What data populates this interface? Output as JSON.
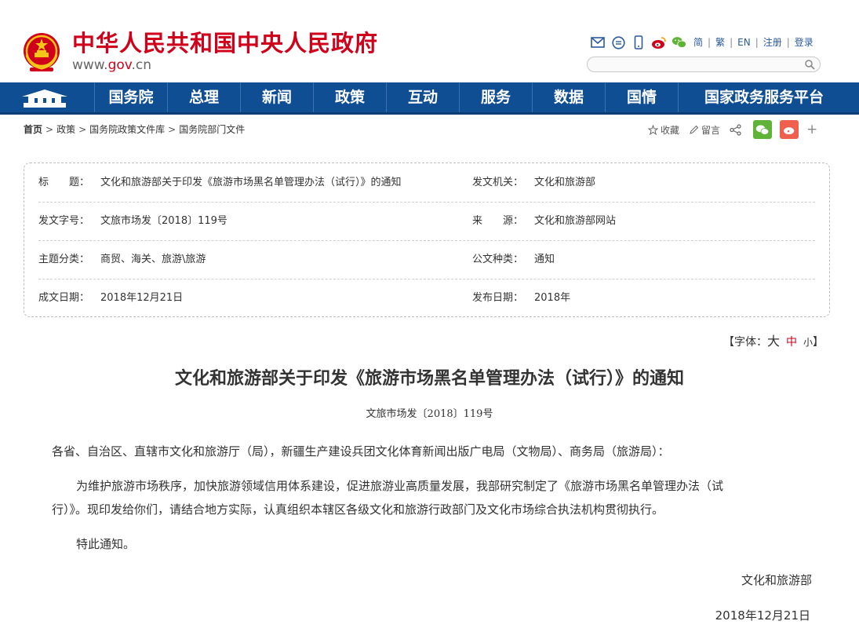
{
  "header": {
    "site_title": "中华人民共和国中央人民政府",
    "url_prefix": "www.",
    "url_domain": "gov",
    "url_suffix": ".cn",
    "icons": [
      "mail-icon",
      "message-icon",
      "mobile-icon",
      "weibo-icon",
      "wechat-icon"
    ],
    "links": [
      "简",
      "繁",
      "EN",
      "注册",
      "登录"
    ],
    "search_placeholder": ""
  },
  "nav": {
    "items": [
      "国务院",
      "总理",
      "新闻",
      "政策",
      "互动",
      "服务",
      "数据",
      "国情",
      "国家政务服务平台"
    ]
  },
  "breadcrumb": {
    "home": "首页",
    "items": [
      "政策",
      "国务院政策文件库",
      "国务院部门文件"
    ],
    "separator": ">"
  },
  "share": {
    "favorite": "收藏",
    "comment": "留言",
    "plus": "+"
  },
  "info": {
    "title_label": "标　　题：",
    "title_value": "文化和旅游部关于印发《旅游市场黑名单管理办法（试行）》的通知",
    "issuer_label": "发文机关：",
    "issuer_value": "文化和旅游部",
    "docno_label": "发文字号：",
    "docno_value": "文旅市场发〔2018〕119号",
    "source_label": "来　　源：",
    "source_value": "文化和旅游部网站",
    "topic_label": "主题分类：",
    "topic_value": "商贸、海关、旅游\\旅游",
    "type_label": "公文种类：",
    "type_value": "通知",
    "written_label": "成文日期：",
    "written_value": "2018年12月21日",
    "published_label": "发布日期：",
    "published_value": "2018年"
  },
  "font_size": {
    "prefix": "【字体：",
    "large": "大",
    "medium": "中",
    "small": "小",
    "suffix": "】"
  },
  "article": {
    "title": "文化和旅游部关于印发《旅游市场黑名单管理办法（试行）》的通知",
    "doc_no": "文旅市场发〔2018〕119号",
    "recipients": "各省、自治区、直辖市文化和旅游厅（局），新疆生产建设兵团文化体育新闻出版广电局（文物局）、商务局（旅游局）：",
    "body_line1": "为维护旅游市场秩序，加快旅游领域信用体系建设，促进旅游业高质量发展，我部研究制定了《旅游市场黑名单管理办法（试",
    "body_line2": "行）》。现印发给你们，请结合地方实际，认真组织本辖区各级文化和旅游行政部门及文化市场综合执法机构贯彻执行。",
    "closing": "特此通知。",
    "signature": "文化和旅游部",
    "date": "2018年12月21日"
  },
  "colors": {
    "brand_red": "#d0021b",
    "nav_blue": "#0f4e93",
    "link_blue": "#2b5a9e",
    "wechat_green": "#5fb336",
    "weibo_red": "#f0604f"
  }
}
